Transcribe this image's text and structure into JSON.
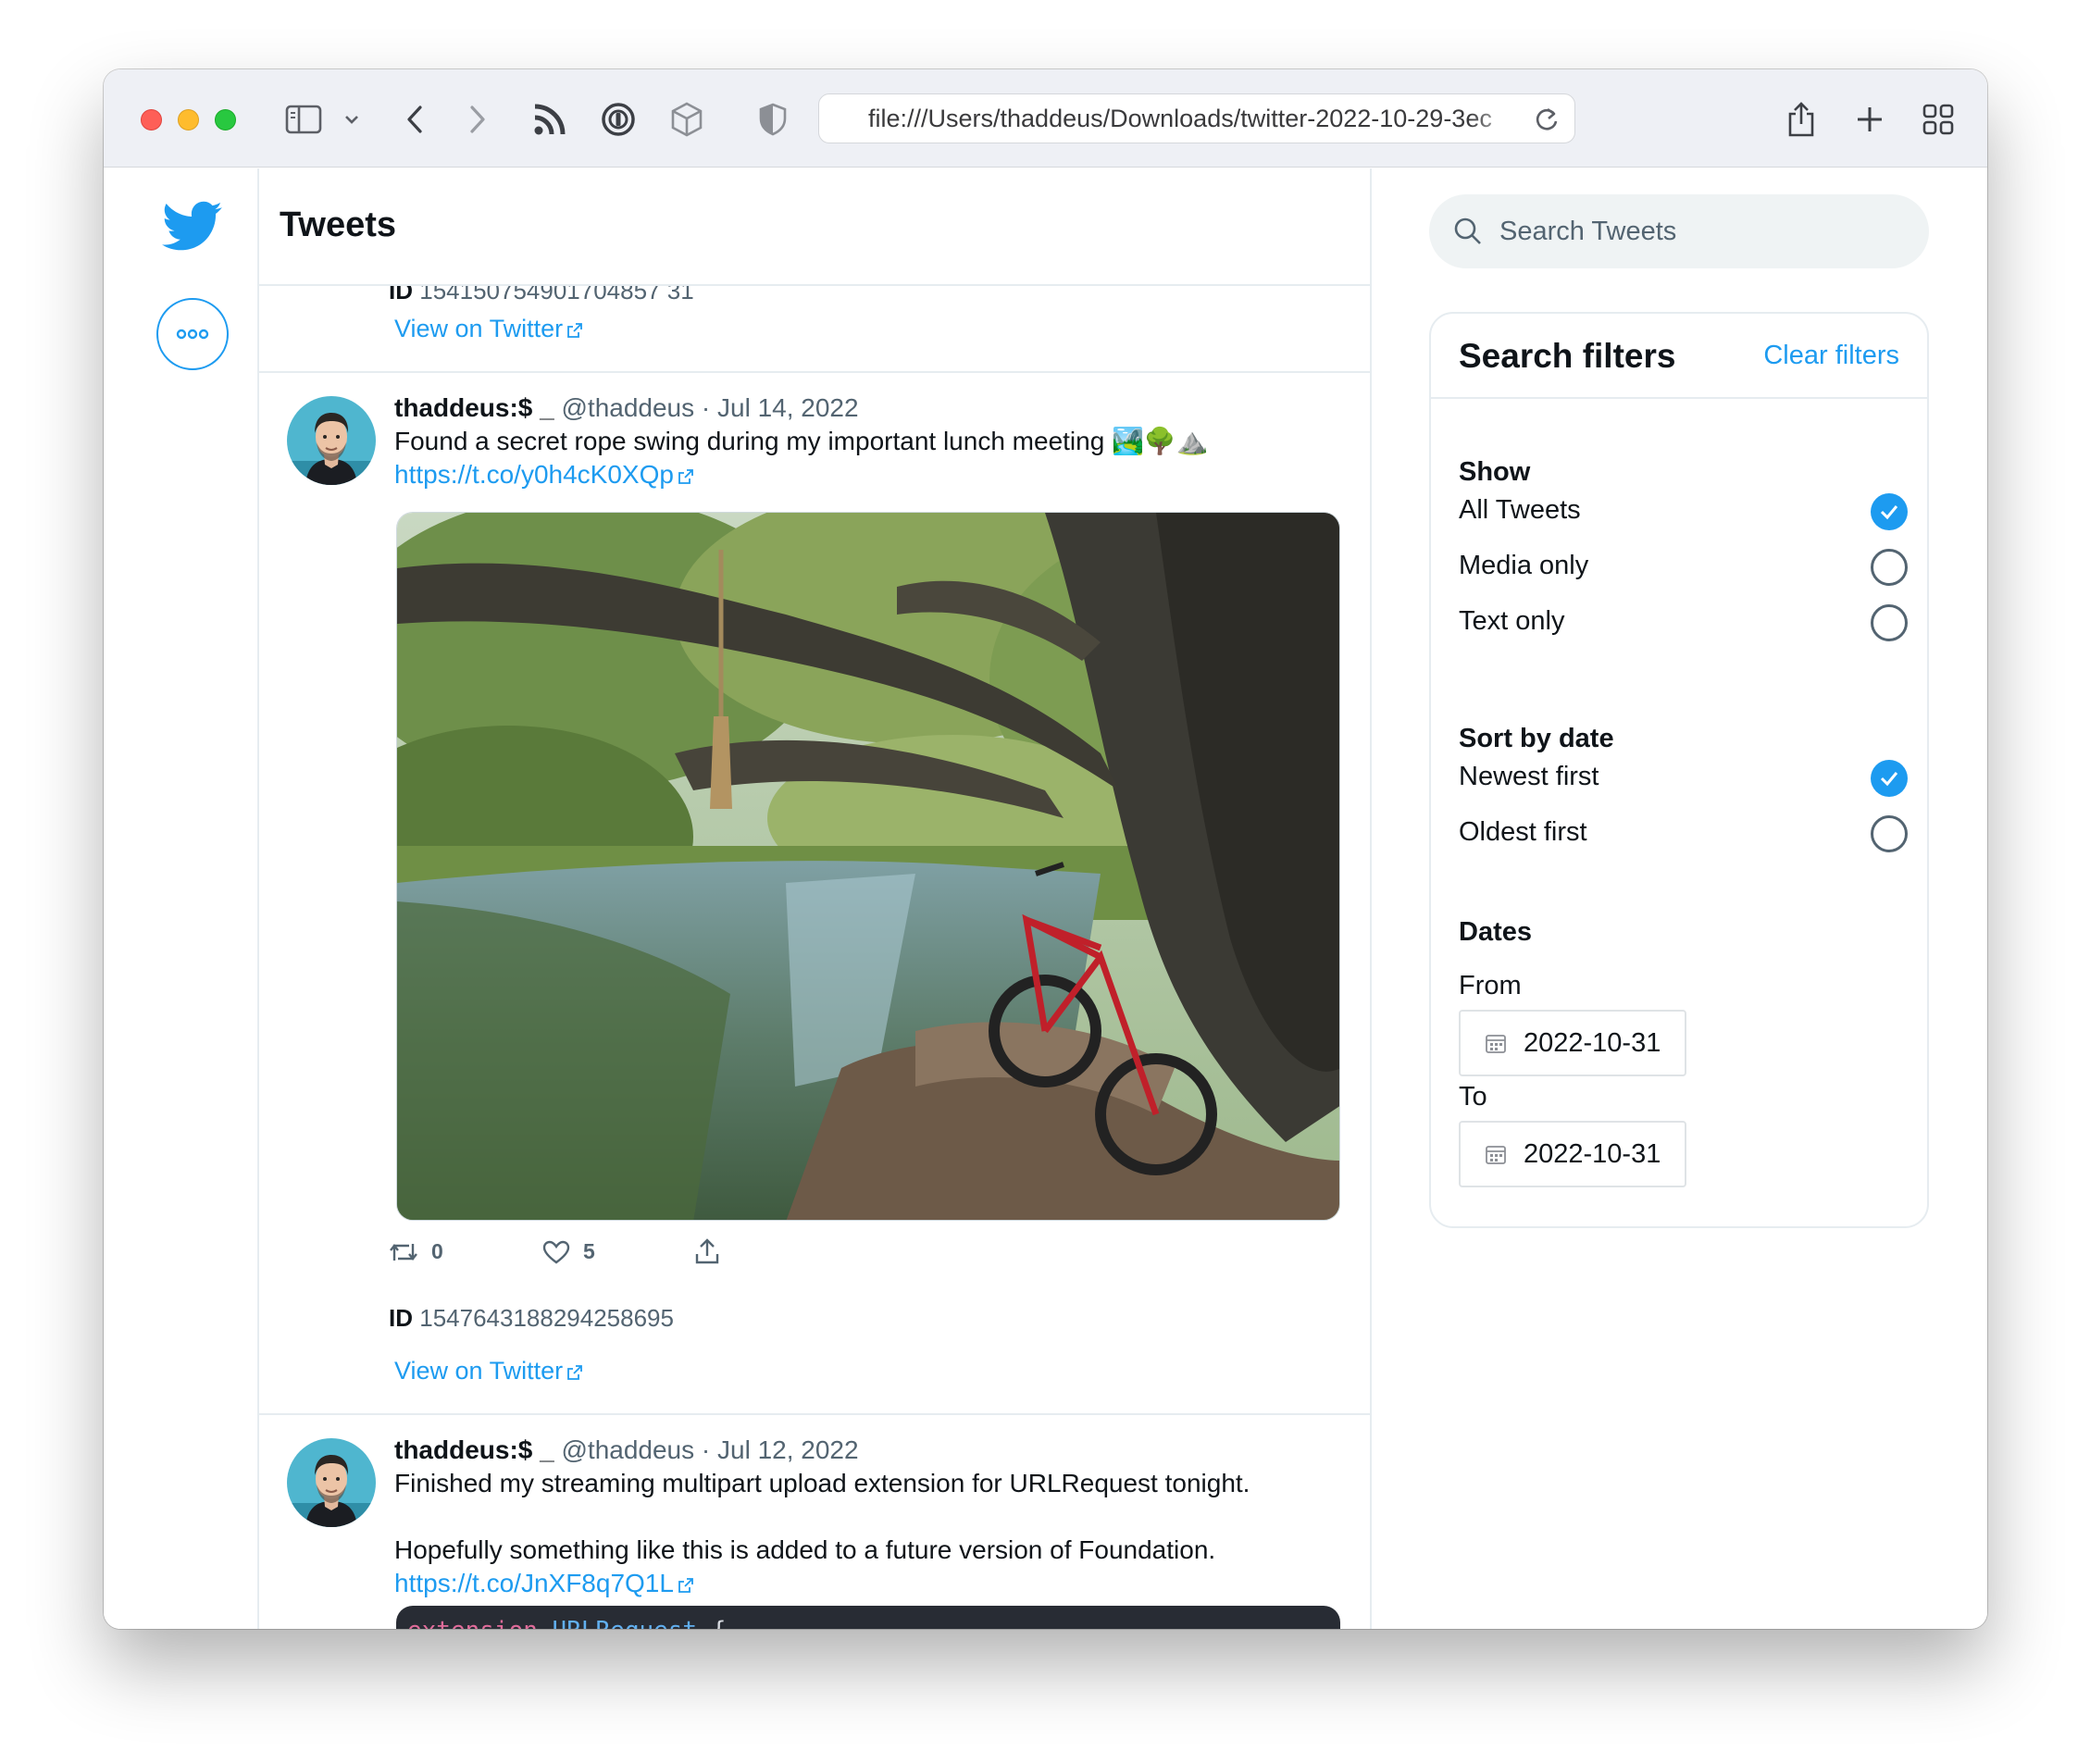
{
  "browser": {
    "url": "file:///Users/thaddeus/Downloads/twitter-2022-10-29-3ec"
  },
  "feed": {
    "title": "Tweets",
    "previous_tweet": {
      "id_label": "ID",
      "id_value": "154150754901704857 31",
      "view_link": "View on Twitter"
    },
    "tweets": [
      {
        "name": "thaddeus:$ _",
        "handle": "@thaddeus",
        "date": "Jul 14, 2022",
        "text": "Found a secret rope swing during my important lunch meeting 🏞️🌳⛰️",
        "link": "https://t.co/y0h4cK0XQp",
        "retweets": "0",
        "likes": "5",
        "id_label": "ID",
        "id_value": "1547643188294258695",
        "view_link": "View on Twitter"
      },
      {
        "name": "thaddeus:$ _",
        "handle": "@thaddeus",
        "date": "Jul 12, 2022",
        "text_line1": "Finished my streaming multipart upload extension for URLRequest tonight.",
        "text_line2": "Hopefully something like this is added to a future version of Foundation.",
        "link": "https://t.co/JnXF8q7Q1L",
        "code_keyword": "extension",
        "code_type": "URLRequest",
        "code_brace": "{"
      }
    ]
  },
  "search": {
    "placeholder": "Search Tweets"
  },
  "filters": {
    "title": "Search filters",
    "clear_label": "Clear filters",
    "show": {
      "heading": "Show",
      "options": [
        {
          "label": "All Tweets",
          "checked": true
        },
        {
          "label": "Media only",
          "checked": false
        },
        {
          "label": "Text only",
          "checked": false
        }
      ]
    },
    "sort": {
      "heading": "Sort by date",
      "options": [
        {
          "label": "Newest first",
          "checked": true
        },
        {
          "label": "Oldest first",
          "checked": false
        }
      ]
    },
    "dates": {
      "heading": "Dates",
      "from_label": "From",
      "from_value": "2022-10-31",
      "to_label": "To",
      "to_value": "2022-10-31"
    }
  },
  "colors": {
    "accent": "#1d9bf0",
    "text": "#0f1419",
    "muted": "#536471"
  }
}
